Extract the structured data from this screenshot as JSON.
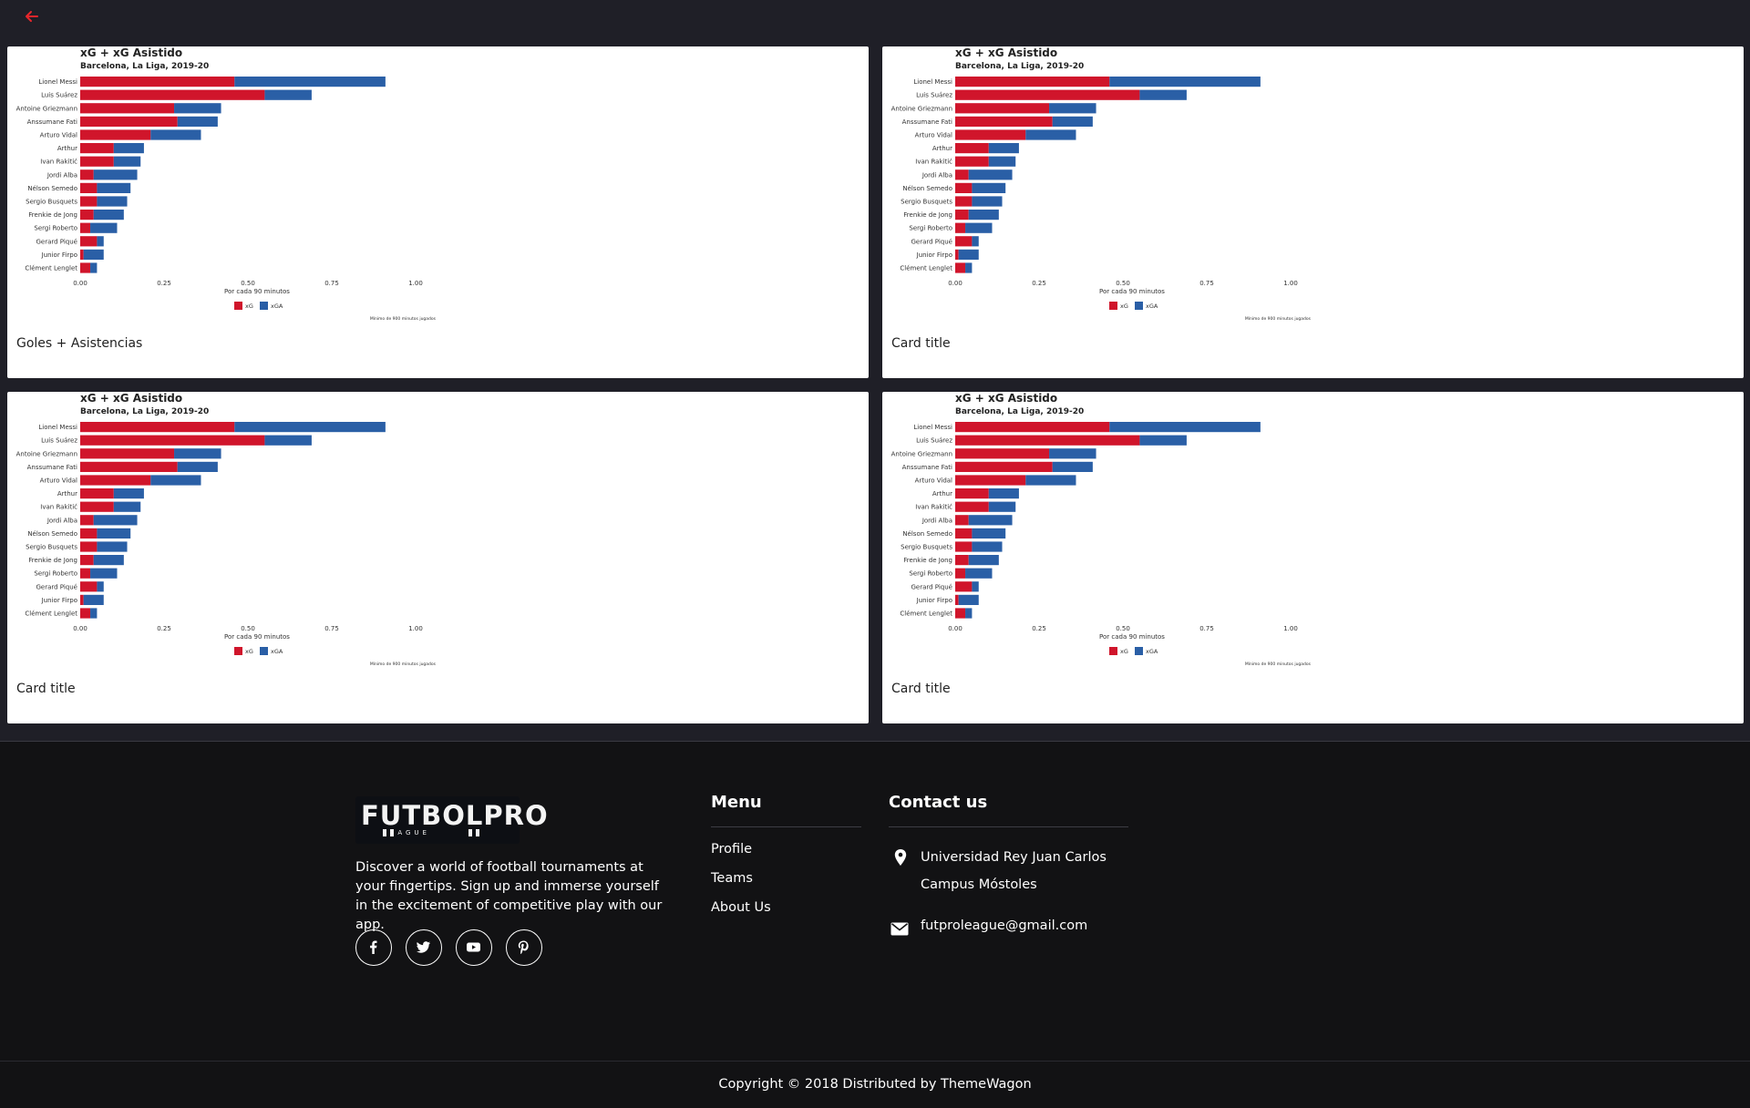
{
  "header": {
    "back_icon": "arrow-left-icon",
    "accent": "#e8262b"
  },
  "charts": [
    {
      "card_title": "Goles + Asistencias",
      "chart_data": {
        "type": "bar",
        "stacked": true,
        "orientation": "horizontal",
        "title": "xG + xG Asistido",
        "subtitle": "Barcelona, La Liga, 2019-20",
        "xlabel": "Por cada 90 minutos",
        "caption": "Mínimo de 900 minutos jugados",
        "xlim": [
          0,
          1.0
        ],
        "xticks": [
          "0.00",
          "0.25",
          "0.50",
          "0.75",
          "1.00"
        ],
        "categories": [
          "Lionel Messi",
          "Luis Suárez",
          "Antoine Griezmann",
          "Anssumane Fati",
          "Arturo Vidal",
          "Arthur",
          "Ivan Rakitić",
          "Jordi Alba",
          "Nélson Semedo",
          "Sergio Busquets",
          "Frenkie de Jong",
          "Sergi Roberto",
          "Gerard Piqué",
          "Junior Firpo",
          "Clément Lenglet"
        ],
        "series": [
          {
            "name": "xG",
            "color": "#d0152b",
            "values": [
              0.46,
              0.55,
              0.28,
              0.29,
              0.21,
              0.1,
              0.1,
              0.04,
              0.05,
              0.05,
              0.04,
              0.03,
              0.05,
              0.01,
              0.03
            ]
          },
          {
            "name": "xGA",
            "color": "#2a5fa6",
            "values": [
              0.45,
              0.14,
              0.14,
              0.12,
              0.15,
              0.09,
              0.08,
              0.13,
              0.1,
              0.09,
              0.09,
              0.08,
              0.02,
              0.06,
              0.02
            ]
          }
        ],
        "legend": "bottom"
      }
    },
    {
      "card_title": "Card title",
      "chart_data": {
        "type": "bar",
        "stacked": true,
        "orientation": "horizontal",
        "title": "xG + xG Asistido",
        "subtitle": "Barcelona, La Liga, 2019-20",
        "xlabel": "Por cada 90 minutos",
        "caption": "Mínimo de 900 minutos jugados",
        "xlim": [
          0,
          1.0
        ],
        "xticks": [
          "0.00",
          "0.25",
          "0.50",
          "0.75",
          "1.00"
        ],
        "categories": [
          "Lionel Messi",
          "Luis Suárez",
          "Antoine Griezmann",
          "Anssumane Fati",
          "Arturo Vidal",
          "Arthur",
          "Ivan Rakitić",
          "Jordi Alba",
          "Nélson Semedo",
          "Sergio Busquets",
          "Frenkie de Jong",
          "Sergi Roberto",
          "Gerard Piqué",
          "Junior Firpo",
          "Clément Lenglet"
        ],
        "series": [
          {
            "name": "xG",
            "color": "#d0152b",
            "values": [
              0.46,
              0.55,
              0.28,
              0.29,
              0.21,
              0.1,
              0.1,
              0.04,
              0.05,
              0.05,
              0.04,
              0.03,
              0.05,
              0.01,
              0.03
            ]
          },
          {
            "name": "xGA",
            "color": "#2a5fa6",
            "values": [
              0.45,
              0.14,
              0.14,
              0.12,
              0.15,
              0.09,
              0.08,
              0.13,
              0.1,
              0.09,
              0.09,
              0.08,
              0.02,
              0.06,
              0.02
            ]
          }
        ],
        "legend": "bottom"
      }
    },
    {
      "card_title": "Card title",
      "chart_data": {
        "type": "bar",
        "stacked": true,
        "orientation": "horizontal",
        "title": "xG + xG Asistido",
        "subtitle": "Barcelona, La Liga, 2019-20",
        "xlabel": "Por cada 90 minutos",
        "caption": "Mínimo de 900 minutos jugados",
        "xlim": [
          0,
          1.0
        ],
        "xticks": [
          "0.00",
          "0.25",
          "0.50",
          "0.75",
          "1.00"
        ],
        "categories": [
          "Lionel Messi",
          "Luis Suárez",
          "Antoine Griezmann",
          "Anssumane Fati",
          "Arturo Vidal",
          "Arthur",
          "Ivan Rakitić",
          "Jordi Alba",
          "Nélson Semedo",
          "Sergio Busquets",
          "Frenkie de Jong",
          "Sergi Roberto",
          "Gerard Piqué",
          "Junior Firpo",
          "Clément Lenglet"
        ],
        "series": [
          {
            "name": "xG",
            "color": "#d0152b",
            "values": [
              0.46,
              0.55,
              0.28,
              0.29,
              0.21,
              0.1,
              0.1,
              0.04,
              0.05,
              0.05,
              0.04,
              0.03,
              0.05,
              0.01,
              0.03
            ]
          },
          {
            "name": "xGA",
            "color": "#2a5fa6",
            "values": [
              0.45,
              0.14,
              0.14,
              0.12,
              0.15,
              0.09,
              0.08,
              0.13,
              0.1,
              0.09,
              0.09,
              0.08,
              0.02,
              0.06,
              0.02
            ]
          }
        ],
        "legend": "bottom"
      }
    },
    {
      "card_title": "Card title",
      "chart_data": {
        "type": "bar",
        "stacked": true,
        "orientation": "horizontal",
        "title": "xG + xG Asistido",
        "subtitle": "Barcelona, La Liga, 2019-20",
        "xlabel": "Por cada 90 minutos",
        "caption": "Mínimo de 900 minutos jugados",
        "xlim": [
          0,
          1.0
        ],
        "xticks": [
          "0.00",
          "0.25",
          "0.50",
          "0.75",
          "1.00"
        ],
        "categories": [
          "Lionel Messi",
          "Luis Suárez",
          "Antoine Griezmann",
          "Anssumane Fati",
          "Arturo Vidal",
          "Arthur",
          "Ivan Rakitić",
          "Jordi Alba",
          "Nélson Semedo",
          "Sergio Busquets",
          "Frenkie de Jong",
          "Sergi Roberto",
          "Gerard Piqué",
          "Junior Firpo",
          "Clément Lenglet"
        ],
        "series": [
          {
            "name": "xG",
            "color": "#d0152b",
            "values": [
              0.46,
              0.55,
              0.28,
              0.29,
              0.21,
              0.1,
              0.1,
              0.04,
              0.05,
              0.05,
              0.04,
              0.03,
              0.05,
              0.01,
              0.03
            ]
          },
          {
            "name": "xGA",
            "color": "#2a5fa6",
            "values": [
              0.45,
              0.14,
              0.14,
              0.12,
              0.15,
              0.09,
              0.08,
              0.13,
              0.1,
              0.09,
              0.09,
              0.08,
              0.02,
              0.06,
              0.02
            ]
          }
        ],
        "legend": "bottom"
      }
    }
  ],
  "footer": {
    "brand_name": "FUTBOLPRO",
    "brand_sub": "LEAGUE",
    "tagline": "Discover a world of football tournaments at your fingertips. Sign up and immerse yourself in the excitement of competitive play with our app.",
    "social": [
      "facebook-icon",
      "twitter-icon",
      "youtube-icon",
      "pinterest-icon"
    ],
    "menu_title": "Menu",
    "menu_items": [
      "Profile",
      "Teams",
      "About Us"
    ],
    "contact_title": "Contact us",
    "address_line1": "Universidad Rey Juan Carlos",
    "address_line2": "Campus Móstoles",
    "email": "futproleague@gmail.com",
    "copyright": "Copyright © 2018 Distributed by ThemeWagon"
  }
}
